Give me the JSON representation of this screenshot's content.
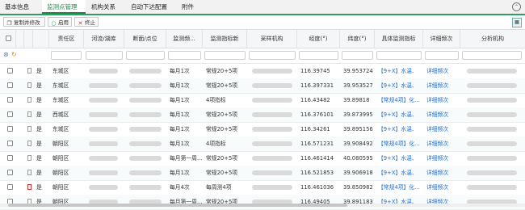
{
  "tabs": [
    {
      "label": "基本信息",
      "active": false
    },
    {
      "label": "监测点管理",
      "active": true
    },
    {
      "label": "机构关系",
      "active": false
    },
    {
      "label": "自动下达配置",
      "active": false
    },
    {
      "label": "附件",
      "active": false
    }
  ],
  "toolbar": {
    "batch_edit_label": "复制并修改",
    "enable_label": "启用",
    "stop_label": "终止"
  },
  "columns": [
    "责任区",
    "河流/湖库",
    "断面/点位",
    "监测频...",
    "监测指标新",
    "采样机构",
    "经度(°)",
    "纬度(°)",
    "具体监测指标",
    "详细频次",
    "分析机构"
  ],
  "rows": [
    {
      "flag": "是",
      "flag_icon": "doc",
      "district": "东城区",
      "freq": "每月1次",
      "indicator": "常规20+5项",
      "lon": "116.39745",
      "lat": "39.953724",
      "specific": "【9+X】水温、",
      "detail": "详细频次"
    },
    {
      "flag": "是",
      "flag_icon": "doc",
      "district": "东城区",
      "freq": "每月1次",
      "indicator": "常规20+5项",
      "lon": "116.397331",
      "lat": "39.953527",
      "specific": "【9+X】水温、",
      "detail": "详细频次"
    },
    {
      "flag": "是",
      "flag_icon": "doc",
      "district": "东城区",
      "freq": "每月1次",
      "indicator": "4项指标",
      "lon": "116.43482",
      "lat": "39.89818",
      "specific": "【常规4项】化...",
      "detail": "详细频次"
    },
    {
      "flag": "是",
      "flag_icon": "doc",
      "district": "西城区",
      "freq": "每月1次",
      "indicator": "常规20+5项",
      "lon": "116.376101",
      "lat": "39.873995",
      "specific": "【9+X】水温、",
      "detail": "详细频次"
    },
    {
      "flag": "是",
      "flag_icon": "doc",
      "district": "东城区",
      "freq": "每月1次",
      "indicator": "常规20+5项",
      "lon": "116.34261",
      "lat": "39.895156",
      "specific": "【9+X】水温、",
      "detail": "详细频次"
    },
    {
      "flag": "是",
      "flag_icon": "doc",
      "district": "朝阳区",
      "freq": "每月1次",
      "indicator": "4项指标",
      "lon": "116.571231",
      "lat": "39.908492",
      "specific": "【常规4项】化...",
      "detail": "详细频次"
    },
    {
      "flag": "是",
      "flag_icon": "doc",
      "district": "朝阳区",
      "freq": "每月第一周...",
      "indicator": "常规20+5项",
      "lon": "116.461414",
      "lat": "40.080595",
      "specific": "【9+X】水温、",
      "detail": "详细频次"
    },
    {
      "flag": "是",
      "flag_icon": "doc",
      "district": "朝阳区",
      "freq": "每月1次",
      "indicator": "常规20+5项",
      "lon": "116.521853",
      "lat": "39.906918",
      "specific": "【9+X】水温、",
      "detail": "详细频次"
    },
    {
      "flag": "是",
      "flag_icon": "doc-red",
      "district": "朝阳区",
      "freq": "每月4次",
      "indicator": "每周测4项",
      "lon": "116.461036",
      "lat": "39.850982",
      "specific": "【常规4项】化...",
      "detail": "详细频次"
    },
    {
      "flag": "是",
      "flag_icon": "doc",
      "district": "朝阳区",
      "freq": "每月第一周...",
      "indicator": "常规20+5项",
      "lon": "116.49405",
      "lat": "39.891183",
      "specific": "【9+X】水温、",
      "detail": "详细频次"
    }
  ],
  "colors": {
    "accent": "#1d8a4c",
    "link": "#1e6fd0"
  },
  "icons": {
    "collapse": "chevron-up-icon",
    "settings": "layout-icon"
  }
}
